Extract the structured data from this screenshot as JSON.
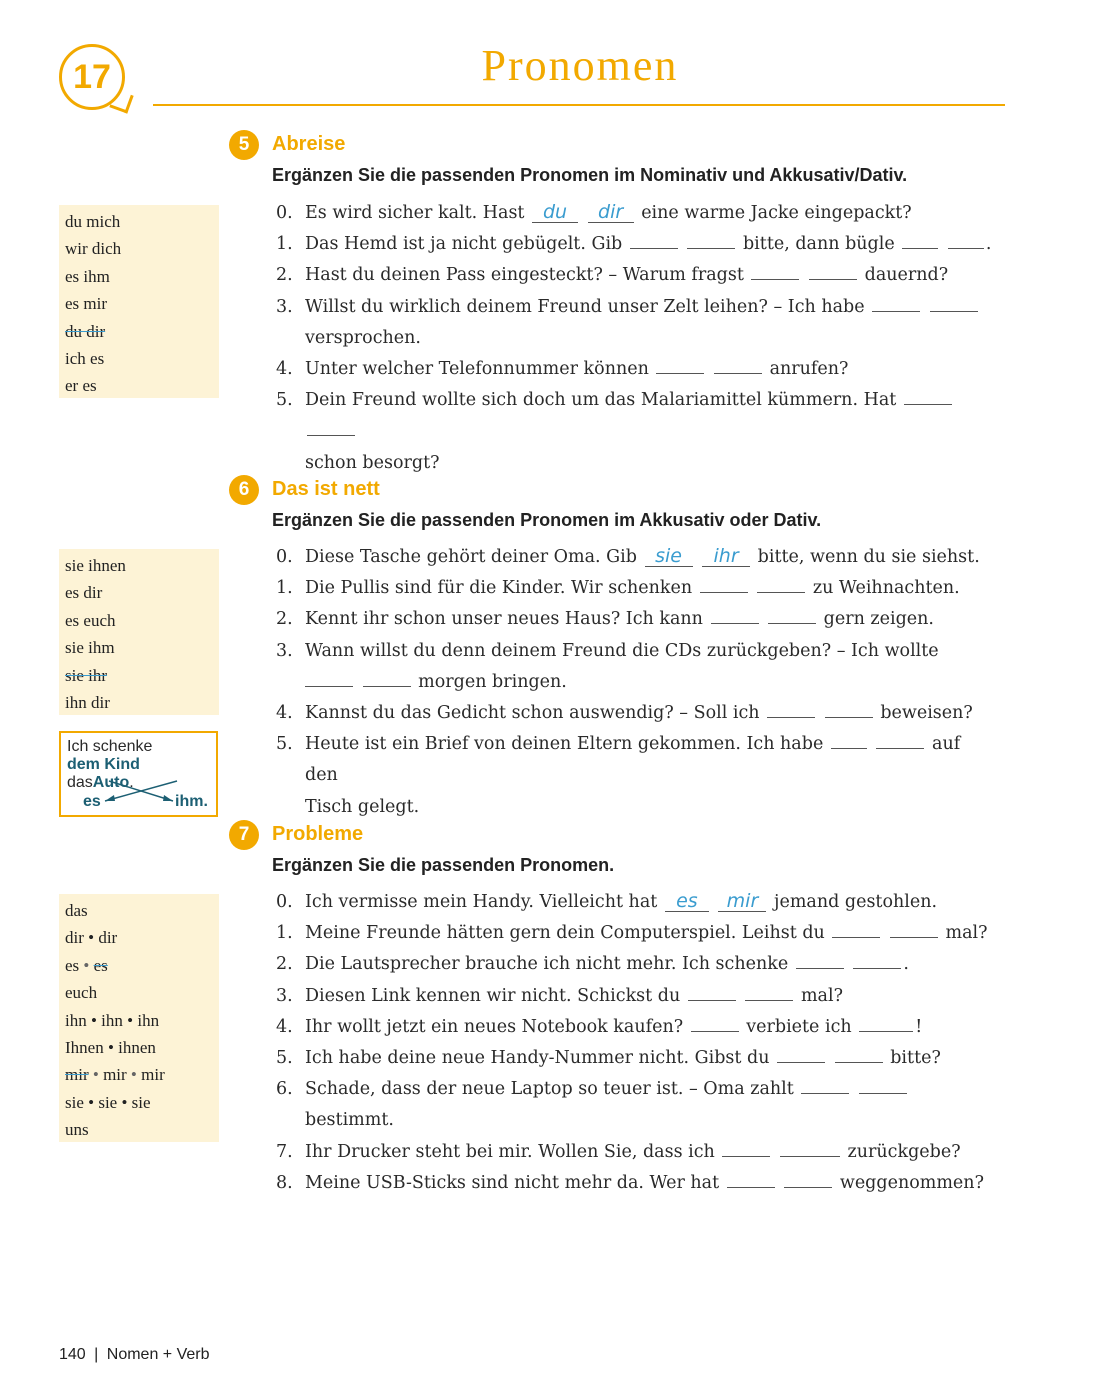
{
  "chapter": {
    "number": "17",
    "title": "Pronomen"
  },
  "exercises": [
    {
      "number": "5",
      "title": "Abreise",
      "instruction": "Ergänzen Sie die passenden Pronomen im Nominativ und Akkusativ/Dativ.",
      "wordbox": [
        "du mich",
        "wir dich",
        "es ihm",
        "es mir",
        "du dir",
        "ich es",
        "er es"
      ],
      "sentences": [
        {
          "n": "0.",
          "parts": [
            "Es wird sicher kalt. Hast",
            "eine warme Jacke eingepackt?"
          ],
          "answers": [
            "du",
            "dir"
          ]
        },
        {
          "n": "1.",
          "parts": [
            "Das Hemd ist ja nicht gebügelt. Gib",
            "bitte, dann bügle",
            "."
          ]
        },
        {
          "n": "2.",
          "parts": [
            "Hast du deinen Pass eingesteckt? – Warum fragst",
            "dauernd?"
          ]
        },
        {
          "n": "3.",
          "parts": [
            "Willst du wirklich deinem Freund unser Zelt leihen? – Ich habe",
            "",
            "versprochen."
          ]
        },
        {
          "n": "4.",
          "parts": [
            "Unter welcher Telefonnummer können",
            "anrufen?"
          ]
        },
        {
          "n": "5.",
          "parts": [
            "Dein Freund wollte sich doch um das Malariamittel kümmern. Hat",
            "",
            "schon besorgt?"
          ]
        }
      ]
    },
    {
      "number": "6",
      "title": "Das ist nett",
      "instruction": "Ergänzen Sie die passenden Pronomen im Akkusativ oder Dativ.",
      "wordbox": [
        "sie ihnen",
        "es dir",
        "es euch",
        "sie ihm",
        "sie ihr",
        "ihn dir"
      ],
      "tip": {
        "line1": "Ich schenke",
        "bold1": "dem Kind",
        "mid": "das",
        "bold2": "Auto",
        "end": ".",
        "left": "es",
        "right": "ihm."
      },
      "sentences": [
        {
          "n": "0.",
          "parts": [
            "Diese Tasche gehört deiner Oma. Gib",
            "bitte, wenn du sie siehst."
          ],
          "answers": [
            "sie",
            "ihr"
          ]
        },
        {
          "n": "1.",
          "parts": [
            "Die Pullis sind für die Kinder. Wir schenken",
            "zu Weihnachten."
          ]
        },
        {
          "n": "2.",
          "parts": [
            "Kennt ihr schon unser neues Haus? Ich kann",
            "gern zeigen."
          ]
        },
        {
          "n": "3.",
          "parts": [
            "Wann willst du denn deinem Freund die CDs zurückgeben? – Ich wollte",
            "",
            "morgen bringen."
          ]
        },
        {
          "n": "4.",
          "parts": [
            "Kannst du das Gedicht schon auswendig? – Soll ich",
            "beweisen?"
          ]
        },
        {
          "n": "5.",
          "parts": [
            "Heute ist ein Brief von deinen Eltern gekommen. Ich habe",
            "auf den",
            "Tisch gelegt."
          ]
        }
      ]
    },
    {
      "number": "7",
      "title": "Probleme",
      "instruction": "Ergänzen Sie die passenden Pronomen.",
      "wordbox": [
        "das",
        "dir • dir",
        "es • es",
        "euch",
        "ihn • ihn • ihn",
        "Ihnen • ihnen",
        "mir • mir • mir",
        "sie • sie • sie",
        "uns"
      ],
      "sentences": [
        {
          "n": "0.",
          "parts": [
            "Ich vermisse mein Handy. Vielleicht hat",
            "jemand gestohlen."
          ],
          "answers": [
            "es",
            "mir"
          ]
        },
        {
          "n": "1.",
          "parts": [
            "Meine Freunde hätten gern dein Computerspiel. Leihst du",
            "mal?"
          ]
        },
        {
          "n": "2.",
          "parts": [
            "Die Lautsprecher brauche ich nicht mehr. Ich schenke",
            "."
          ]
        },
        {
          "n": "3.",
          "parts": [
            "Diesen Link kennen wir nicht. Schickst du",
            "mal?"
          ]
        },
        {
          "n": "4.",
          "parts": [
            "Ihr wollt jetzt ein neues Notebook kaufen?",
            "verbiete ich",
            "!"
          ]
        },
        {
          "n": "5.",
          "parts": [
            "Ich habe deine neue Handy-Nummer nicht. Gibst du",
            "bitte?"
          ]
        },
        {
          "n": "6.",
          "parts": [
            "Schade, dass der neue Laptop so teuer ist. – Oma zahlt",
            "bestimmt."
          ]
        },
        {
          "n": "7.",
          "parts": [
            "Ihr Drucker steht bei mir. Wollen Sie, dass ich",
            "zurückgebe?"
          ]
        },
        {
          "n": "8.",
          "parts": [
            "Meine USB-Sticks sind nicht mehr da. Wer hat",
            "weggenommen?"
          ]
        }
      ]
    }
  ],
  "footer": {
    "page": "140",
    "sep": "|",
    "section": "Nomen + Verb"
  }
}
